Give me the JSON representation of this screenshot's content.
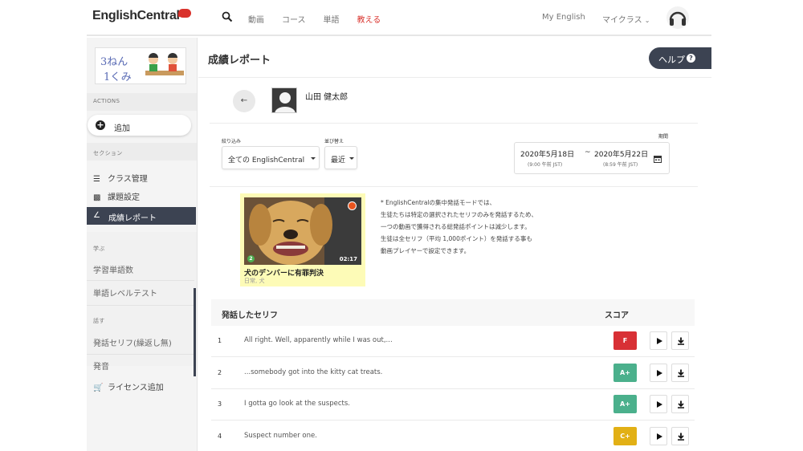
{
  "nav": {
    "logo": "EnglishCentral",
    "links": [
      "動画",
      "コース",
      "単語",
      "教える"
    ],
    "active_link": "教える",
    "my_english": "My English",
    "my_class": "マイクラス"
  },
  "sidebar": {
    "actions_heading": "ACTIONS",
    "add_label": "追加",
    "section_heading": "セクション",
    "items": [
      {
        "label": "クラス管理",
        "icon": "list-icon"
      },
      {
        "label": "課題設定",
        "icon": "book-icon"
      },
      {
        "label": "成績レポート",
        "icon": "chart-icon"
      }
    ],
    "learn_heading": "学ぶ",
    "learn_items": [
      "学習単語数",
      "単語レベルテスト"
    ],
    "speak_heading": "話す",
    "speak_items": [
      "発話セリフ(繰返し無)",
      "発音"
    ],
    "license_label": "ライセンス追加"
  },
  "main": {
    "title": "成績レポート",
    "help_label": "ヘルプ",
    "student_name": "山田 健太郎",
    "filter_label": "絞り込み",
    "filter_value": "全ての EnglishCentral",
    "sort_label": "並び替え",
    "sort_value": "最近",
    "period_label": "期間",
    "period_start": "2020年5月18日",
    "period_start_time": "(9:00 午前 JST)",
    "period_end": "2020年5月22日",
    "period_end_time": "(8:59 午前 JST)",
    "period_sep": "~",
    "video": {
      "title": "犬のデンバーに有罪判決",
      "category": "日常, 犬",
      "duration": "02:17",
      "level": "2"
    },
    "note_lines": [
      "* EnglishCentralの集中発話モードでは、",
      "生徒たちは特定の選択されたセリフのみを発話するため、",
      "一つの動画で獲得される総発話ポイントは減少します。",
      "生徒は全セリフ（平均 1,000ポイント）を発話する事も",
      "動画プレイヤーで設定できます。"
    ],
    "table": {
      "col_lines": "発話したセリフ",
      "col_score": "スコア",
      "rows": [
        {
          "num": "1",
          "line": "All right. Well, apparently while I was out,...",
          "grade": "F",
          "color": "#d83035"
        },
        {
          "num": "2",
          "line": "...somebody got into the kitty cat treats.",
          "grade": "A+",
          "color": "#4bb08c"
        },
        {
          "num": "3",
          "line": "I gotta go look at the suspects.",
          "grade": "A+",
          "color": "#4bb08c"
        },
        {
          "num": "4",
          "line": "Suspect number one.",
          "grade": "C+",
          "color": "#e2b015"
        }
      ]
    }
  }
}
